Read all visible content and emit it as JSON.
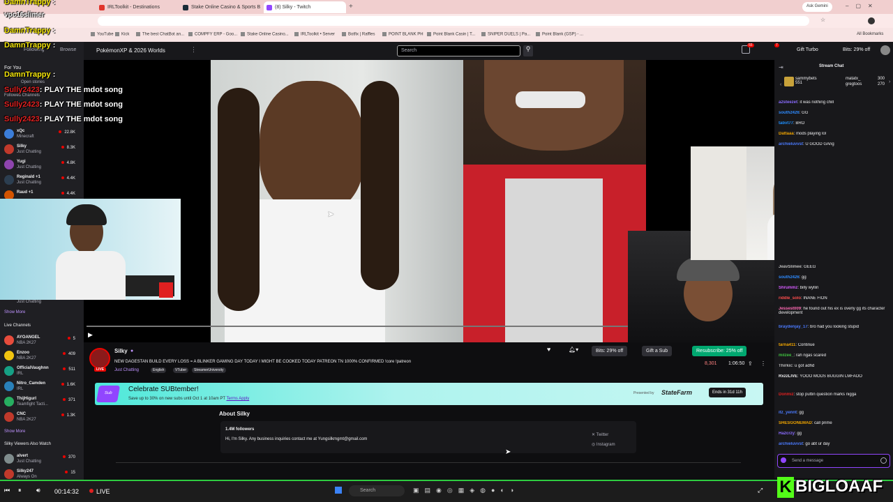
{
  "browser": {
    "tabs": [
      {
        "label": "IRLToolkit - Destinations",
        "color": "#e0352b"
      },
      {
        "label": "Stake Online Casino & Sports B",
        "color": "#1a2c38"
      },
      {
        "label": "(8) Silky - Twitch",
        "color": "#9146ff"
      }
    ],
    "ask_gemini": "Ask Gemini",
    "bookmarks": [
      "YouTube",
      "Kick",
      "The best ChatBot an...",
      "COMPFY ERP - Goo...",
      "Stake Online Casino...",
      "IRLToolkit • Server",
      "Botfix | Raffles",
      "POINT BLANK PH",
      "Point Blank Casin | T...",
      "SNIPER DUELS | Pa...",
      "Point Blank (GSP) - ..."
    ],
    "all_bookmarks": "All Bookmarks"
  },
  "twitch": {
    "category_title": "PokémonXP & 2026 Worlds",
    "search_placeholder": "Search",
    "gift_turbo": "Gift Turbo",
    "bits_offer": "Bits: 29% off",
    "notif_count_1": "55",
    "notif_count_2": "7"
  },
  "overlay_chat": [
    {
      "user": "DamnTrappy",
      "msg": ":"
    },
    {
      "user": "vpc16slimer",
      "msg": ""
    },
    {
      "user": "DamnTrappy",
      "msg": ":"
    },
    {
      "user": "DamnTrappy",
      "msg": ":"
    },
    {
      "user": "DamnTrappy",
      "msg": ":"
    },
    {
      "user": "Sully2423",
      "msg": ": PLAY THE mdot song"
    },
    {
      "user": "Sully2423",
      "msg": ": PLAY THE mdot song"
    },
    {
      "user": "Sully2423",
      "msg": ": PLAY THE mdot song"
    }
  ],
  "sidebar": {
    "following": "Following",
    "browse": "Browse",
    "for_you": "For You",
    "open_stories": "Open stories",
    "followed_channels": "Followed Channels",
    "channels": [
      {
        "name": "xQc",
        "game": "Minecraft",
        "viewers": "22.8K",
        "color": "#3b7dd8"
      },
      {
        "name": "Silky",
        "game": "Just Chatting",
        "viewers": "8.3K",
        "color": "#c0392b"
      },
      {
        "name": "Yugi",
        "game": "Just Chatting",
        "viewers": "4.8K",
        "color": "#8e44ad"
      },
      {
        "name": "Reginald +1",
        "game": "Just Chatting",
        "viewers": "4.4K",
        "color": "#2c3e50"
      },
      {
        "name": "Raud +1",
        "game": "",
        "viewers": "4.4K",
        "color": "#d35400"
      }
    ],
    "show_more": "Show More",
    "live_channels": "Live Channels",
    "live": [
      {
        "name": "AYOANGEL",
        "game": "NBA 2K27",
        "viewers": "5",
        "color": "#e74c3c"
      },
      {
        "name": "Enzoo",
        "game": "NBA 2K27",
        "viewers": "409",
        "color": "#f1c40f"
      },
      {
        "name": "OfficialVaughnn",
        "game": "IRL",
        "viewers": "511",
        "color": "#16a085"
      },
      {
        "name": "Nitro_Camden",
        "game": "IRL",
        "viewers": "1.6K",
        "color": "#2980b9"
      },
      {
        "name": "ThijHigurl",
        "game": "Teamfight Tacti...",
        "viewers": "371",
        "color": "#27ae60"
      },
      {
        "name": "CNC",
        "game": "NBA 2K27",
        "viewers": "1.3K",
        "color": "#c0392b"
      }
    ],
    "also_watch": "Silky Viewers Also Watch",
    "also": [
      {
        "name": "alvert",
        "game": "Just Chatting",
        "viewers": "370",
        "color": "#7f8c8d"
      },
      {
        "name": "Silky247",
        "game": "Always On",
        "viewers": "15",
        "color": "#c0392b"
      }
    ],
    "just_chatting": "Just Chatting"
  },
  "stream": {
    "streamer": "Silky",
    "title": "NEW DAGESTAN BUILD EVERY LOSS = A BLINKER GAMING DAY TODAY I MIGHT BE COOKED TODAY PATREON TN 1000% CONFIRMED !core !patreon",
    "category": "Just Chatting",
    "tags": [
      "English",
      "VTuber",
      "StreamerUniversity"
    ],
    "live_badge": "LIVE",
    "bits_btn": "Bits: 29% off",
    "gift_btn": "Gift a Sub",
    "resub_btn": "Resubscribe: 25% off",
    "viewers": "8,301",
    "uptime": "1:06:50",
    "promo_title": "Celebrate SUBtember!",
    "promo_sub": "Save up to 30% on new subs until Oct 1 at 10am PT",
    "promo_terms": "Terms Apply",
    "promo_presented": "Presented by",
    "promo_sponsor": "StateFarm",
    "promo_ends": "Ends in 31d 11h",
    "about_title": "About Silky",
    "followers": "1.4M followers",
    "bio": "Hi, I'm Silky. Any business inquiries contact me at Yungsilkmgmt@gmail.com",
    "twitter": "Twitter",
    "instagram": "Instagram"
  },
  "chat": {
    "header": "Stream Chat",
    "top_gifters": [
      {
        "name": "sammybets",
        "count": "551"
      },
      {
        "name": "matatx_",
        "count": "300"
      },
      {
        "name": "gregtoos",
        "count": "270"
      }
    ],
    "messages_top": [
      {
        "user": "a2steezet",
        "msg": ": it was nothing chill",
        "color": "#8a6bff"
      },
      {
        "user": "south2426",
        "msg": ": GG",
        "color": "#2e8bff"
      },
      {
        "user": "tabvt77",
        "msg": ": BRO",
        "color": "#1e90ff"
      },
      {
        "user": "Dattaaa",
        "msg": ": mods playing lol",
        "color": "#f0a500"
      },
      {
        "user": "archieluvvst",
        "msg": ": U GOOD GAng",
        "color": "#4b7bff"
      }
    ],
    "messages": [
      {
        "user": "JeavSlimee",
        "msg": ": GEEG",
        "color": "#bdbdbd"
      },
      {
        "user": "south2426",
        "msg": ": gg",
        "color": "#2e8bff"
      },
      {
        "user": "Shrummz",
        "msg": ": billy wyllin",
        "color": "#d65cff"
      },
      {
        "user": "riddle_solo",
        "msg": ": INANE FION",
        "color": "#ff4d4d"
      },
      {
        "user": "Jessest009",
        "msg": ": he found out his ex is overly gg its character development",
        "color": "#ff69b4"
      },
      {
        "user": "braydenjay_17",
        "msg": ": bro had you looking stupid",
        "color": "#4b7bff"
      },
      {
        "user": "tarna411",
        "msg": ": Continue",
        "color": "#f0a500"
      },
      {
        "user": "milzee_",
        "msg": ": rah ngas scared",
        "color": "#3fbf3f"
      },
      {
        "user": "Thirkic",
        "msg": ": u got adhd",
        "color": "#bdbdbd"
      },
      {
        "user": "RxzzLIVE",
        "msg": ": YOOO MODS BUGGIN LMFAOO",
        "color": "#efeff1"
      },
      {
        "user": "Donmiz",
        "msg": ": stop puttin question marks nigga",
        "color": "#e02020"
      },
      {
        "user": "itz_yennt",
        "msg": ": gg",
        "color": "#4b7bff"
      },
      {
        "user": "SHESGONEMAD",
        "msg": ": call prime",
        "color": "#f0a500"
      },
      {
        "user": "Ha2crzy",
        "msg": ": gg",
        "color": "#8a6bff"
      },
      {
        "user": "archieluvvst",
        "msg": ": go abt ur day",
        "color": "#4b7bff"
      }
    ],
    "placeholder": "Send a message",
    "chat_btn": "Chat"
  },
  "player": {
    "time": "00:14:32",
    "live": "LIVE",
    "taskbar_search": "Search",
    "watermark": "BIGLOAAF"
  }
}
